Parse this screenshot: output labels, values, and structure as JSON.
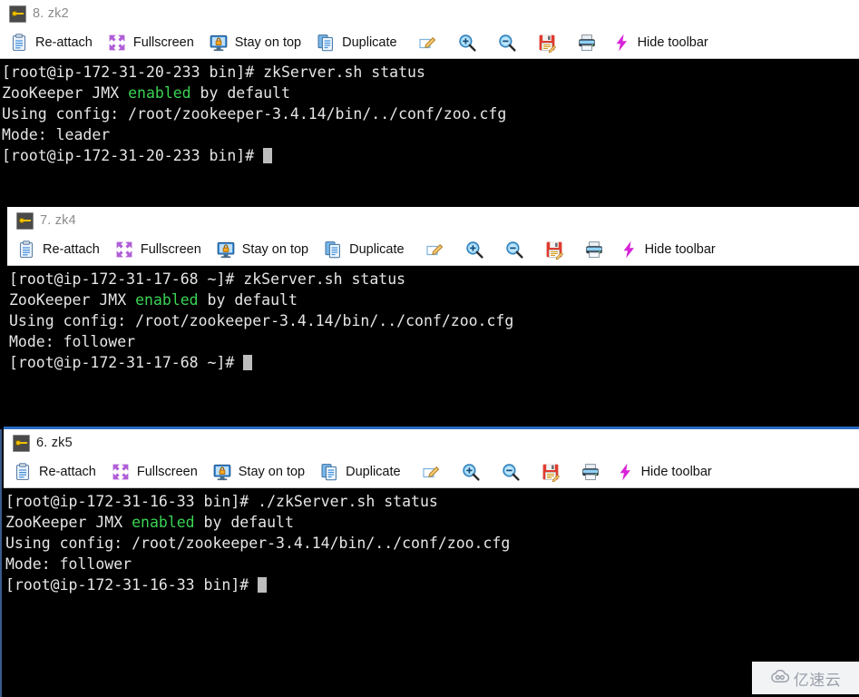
{
  "toolbar": {
    "items": [
      {
        "icon": "clipboard-icon",
        "label": "Re-attach"
      },
      {
        "icon": "fullscreen-arrows-icon",
        "label": "Fullscreen"
      },
      {
        "icon": "monitor-lock-icon",
        "label": "Stay on top"
      },
      {
        "icon": "duplicate-pages-icon",
        "label": "Duplicate"
      },
      {
        "icon": "edit-pencil-icon",
        "label": ""
      },
      {
        "icon": "zoom-in-icon",
        "label": ""
      },
      {
        "icon": "zoom-out-icon",
        "label": ""
      },
      {
        "icon": "save-floppy-icon",
        "label": ""
      },
      {
        "icon": "printer-icon",
        "label": ""
      },
      {
        "icon": "lightning-bolt-icon",
        "label": "Hide toolbar"
      }
    ]
  },
  "colors": {
    "terminal_background": "#000000",
    "terminal_text": "#e6e6e6",
    "highlight_green": "#39d353",
    "active_window_border": "#2a6cc4",
    "inactive_title": "#8c8c8c",
    "active_title": "#1a1a1a"
  },
  "windows": [
    {
      "id": "zk2",
      "title": "8. zk2",
      "title_state": "inactive",
      "lines": [
        {
          "segments": [
            {
              "t": "[root@ip-172-31-20-233 bin]# zkServer.sh status"
            }
          ]
        },
        {
          "segments": [
            {
              "t": "ZooKeeper JMX "
            },
            {
              "t": "enabled",
              "c": "green"
            },
            {
              "t": " by default"
            }
          ]
        },
        {
          "segments": [
            {
              "t": "Using config: /root/zookeeper-3.4.14/bin/../conf/zoo.cfg"
            }
          ]
        },
        {
          "segments": [
            {
              "t": "Mode: leader"
            }
          ]
        },
        {
          "segments": [
            {
              "t": "[root@ip-172-31-20-233 bin]# "
            }
          ],
          "cursor": true
        }
      ]
    },
    {
      "id": "zk4",
      "title": "7. zk4",
      "title_state": "inactive",
      "lines": [
        {
          "segments": [
            {
              "t": "[root@ip-172-31-17-68 ~]# zkServer.sh status"
            }
          ]
        },
        {
          "segments": [
            {
              "t": "ZooKeeper JMX "
            },
            {
              "t": "enabled",
              "c": "green"
            },
            {
              "t": " by default"
            }
          ]
        },
        {
          "segments": [
            {
              "t": "Using config: /root/zookeeper-3.4.14/bin/../conf/zoo.cfg"
            }
          ]
        },
        {
          "segments": [
            {
              "t": "Mode: follower"
            }
          ]
        },
        {
          "segments": [
            {
              "t": "[root@ip-172-31-17-68 ~]# "
            }
          ],
          "cursor": true
        }
      ]
    },
    {
      "id": "zk5",
      "title": "6. zk5",
      "title_state": "active",
      "lines": [
        {
          "segments": [
            {
              "t": "[root@ip-172-31-16-33 bin]# ./zkServer.sh status"
            }
          ]
        },
        {
          "segments": [
            {
              "t": "ZooKeeper JMX "
            },
            {
              "t": "enabled",
              "c": "green"
            },
            {
              "t": " by default"
            }
          ]
        },
        {
          "segments": [
            {
              "t": "Using config: /root/zookeeper-3.4.14/bin/../conf/zoo.cfg"
            }
          ]
        },
        {
          "segments": [
            {
              "t": "Mode: follower"
            }
          ]
        },
        {
          "segments": [
            {
              "t": "[root@ip-172-31-16-33 bin]# "
            }
          ],
          "cursor": true
        }
      ]
    }
  ],
  "watermark": {
    "icon": "cloud-icon",
    "text": "亿速云"
  }
}
